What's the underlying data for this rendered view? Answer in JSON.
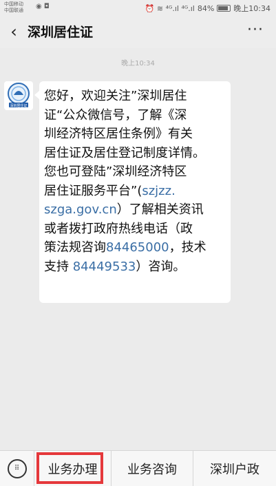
{
  "status_bar": {
    "carrier_1": "中国移动",
    "carrier_2": "中国联通",
    "left_icons": "◉ ◘",
    "right_icons": "⏰ ≋ ⁴ᴳ.ıl ⁴ᴳ.ıl",
    "battery": "84%",
    "time": "晚上10:34"
  },
  "header": {
    "title": "深圳居住证",
    "back_glyph": "‹",
    "more_glyph": "···"
  },
  "chat": {
    "time_label": "晚上10:34",
    "avatar_label": "深圳居住证",
    "message_lines": [
      [
        {
          "t": "您好，欢迎关注”深圳居住"
        }
      ],
      [
        {
          "t": "证“公众微信号，了解《深"
        }
      ],
      [
        {
          "t": "圳经济特区居住条例》有关"
        }
      ],
      [
        {
          "t": "居住证及居住登记制度详情。"
        }
      ],
      [
        {
          "t": "您也可登陆”深圳经济特区"
        }
      ],
      [
        {
          "t": "居住证服务平台”("
        },
        {
          "t": "szjzz.",
          "link": true
        }
      ],
      [
        {
          "t": "szga.gov.cn",
          "link": true
        },
        {
          "t": "）了解相关资讯"
        }
      ],
      [
        {
          "t": "或者拨打政府热线电话（政"
        }
      ],
      [
        {
          "t": "策法规咨询"
        },
        {
          "t": "84465000",
          "link": true
        },
        {
          "t": "，技术"
        }
      ],
      [
        {
          "t": "支持 "
        },
        {
          "t": "84449533",
          "link": true
        },
        {
          "t": "）咨询。"
        }
      ]
    ]
  },
  "menu": {
    "items": [
      "业务办理",
      "业务咨询",
      "深圳户政"
    ]
  },
  "colors": {
    "link": "#3a6ea5",
    "highlight": "#e5383b",
    "background": "#ebebeb"
  }
}
